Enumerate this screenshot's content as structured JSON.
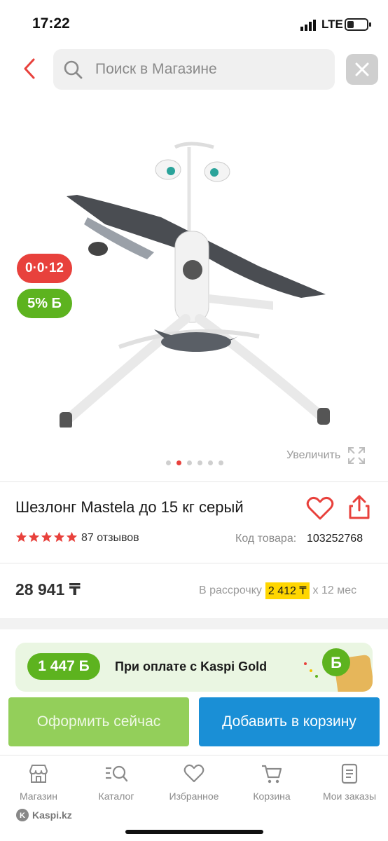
{
  "status_bar": {
    "time": "17:22",
    "network": "LTE"
  },
  "header": {
    "search_placeholder": "Поиск в Магазине"
  },
  "gallery": {
    "badge_installment": "0·0·12",
    "badge_bonus": "5% Б",
    "zoom_label": "Увеличить",
    "image_count": 6,
    "active_index": 1
  },
  "product": {
    "title": "Шезлонг Mastela до 15 кг серый",
    "rating_stars": 5,
    "reviews": "87 отзывов",
    "code_label": "Код товара:",
    "code_value": "103252768",
    "price": "28 941 ₸",
    "installment_prefix": "В рассрочку",
    "installment_amount": "2 412 ₸",
    "installment_suffix": "x 12 мес"
  },
  "kaspi_gold": {
    "bonus": "1 447 Б",
    "text": "При оплате с Kaspi Gold"
  },
  "actions": {
    "buy_now": "Оформить сейчас",
    "add_to_cart": "Добавить в корзину"
  },
  "bottom_nav": [
    {
      "label": "Магазин",
      "icon": "store-icon"
    },
    {
      "label": "Каталог",
      "icon": "catalog-search-icon"
    },
    {
      "label": "Избранное",
      "icon": "heart-icon"
    },
    {
      "label": "Корзина",
      "icon": "cart-icon"
    },
    {
      "label": "Мои заказы",
      "icon": "orders-icon"
    }
  ],
  "watermark": "Kaspi.kz",
  "colors": {
    "accent_red": "#e8413c",
    "bonus_green": "#5db31f",
    "cart_blue": "#1a8fd6",
    "highlight_yellow": "#ffd600"
  }
}
